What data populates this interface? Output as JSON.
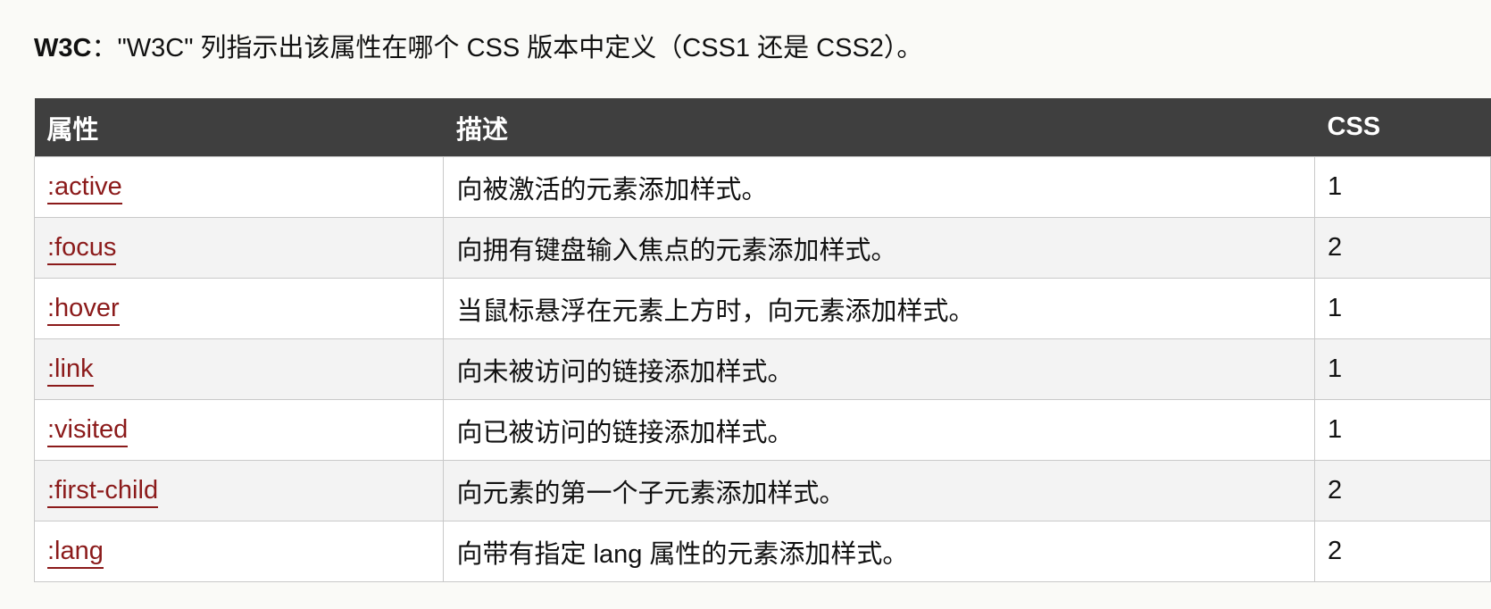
{
  "intro": {
    "label": "W3C",
    "text": "：\"W3C\" 列指示出该属性在哪个 CSS 版本中定义（CSS1 还是 CSS2）。"
  },
  "table": {
    "headers": [
      "属性",
      "描述",
      "CSS"
    ],
    "rows": [
      {
        "property": ":active",
        "description": "向被激活的元素添加样式。",
        "css": "1"
      },
      {
        "property": ":focus",
        "description": "向拥有键盘输入焦点的元素添加样式。",
        "css": "2"
      },
      {
        "property": ":hover",
        "description": "当鼠标悬浮在元素上方时，向元素添加样式。",
        "css": "1"
      },
      {
        "property": ":link",
        "description": "向未被访问的链接添加样式。",
        "css": "1"
      },
      {
        "property": ":visited",
        "description": "向已被访问的链接添加样式。",
        "css": "1"
      },
      {
        "property": ":first-child",
        "description": "向元素的第一个子元素添加样式。",
        "css": "2"
      },
      {
        "property": ":lang",
        "description": "向带有指定 lang 属性的元素添加样式。",
        "css": "2"
      }
    ]
  },
  "colors": {
    "header_bg": "#3f3f3f",
    "link": "#8b1a1a",
    "alt_row": "#f3f3f3",
    "border": "#c9c9c9"
  }
}
